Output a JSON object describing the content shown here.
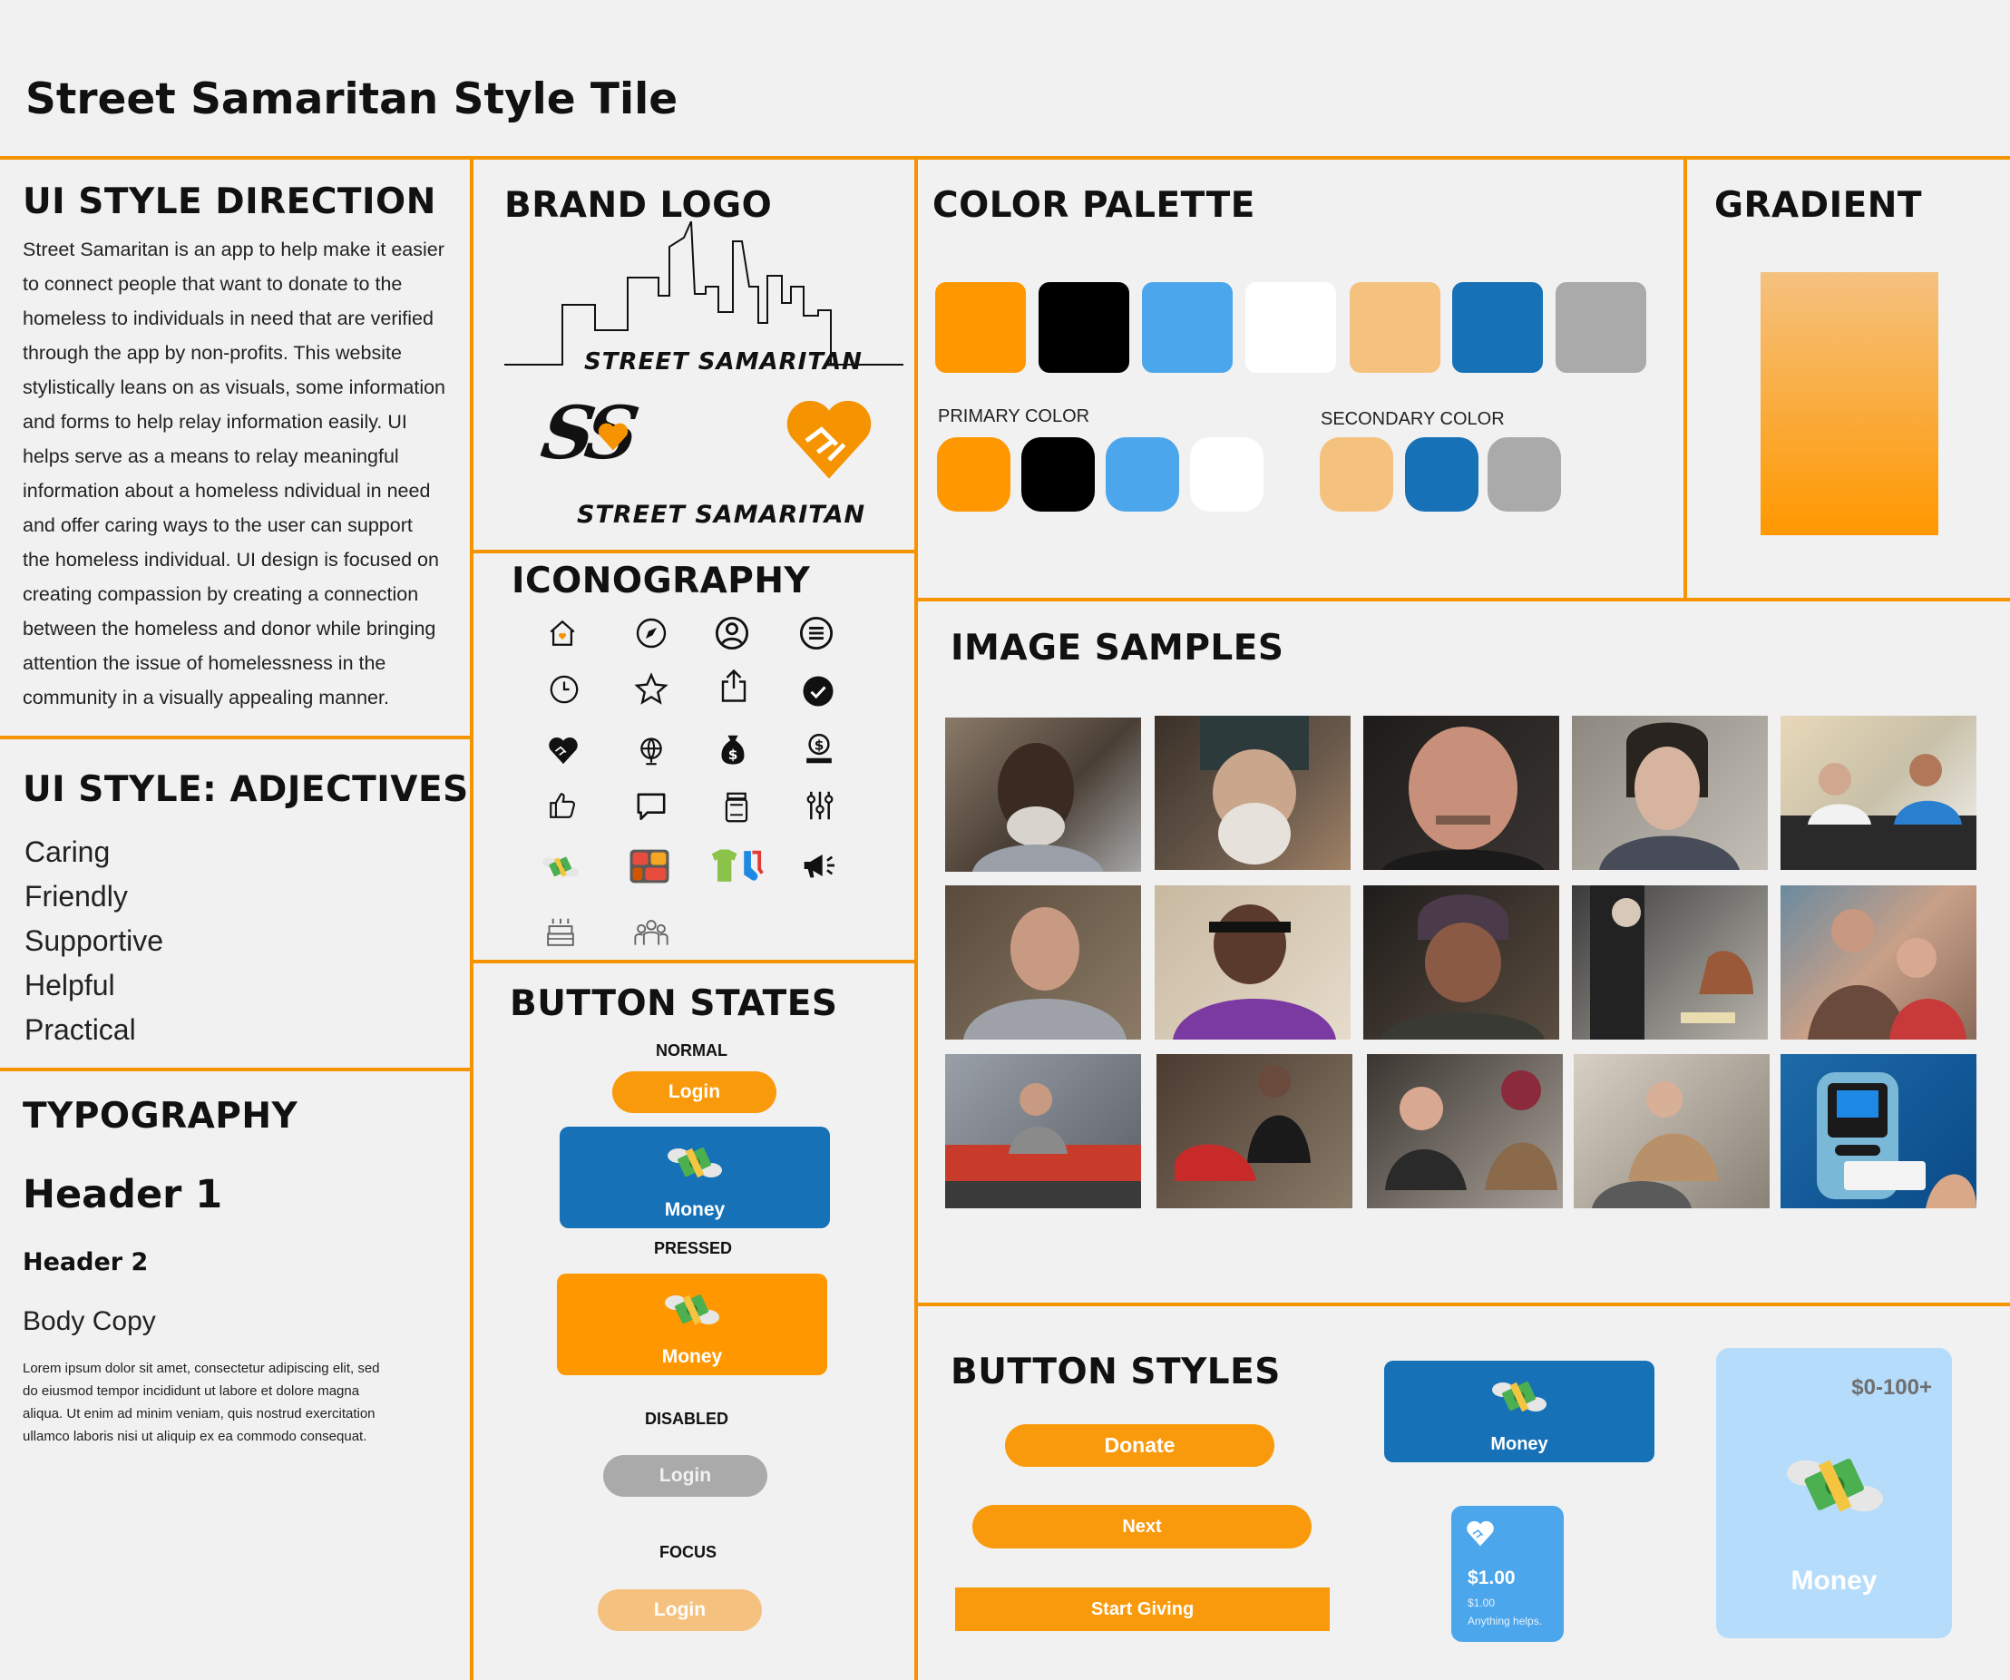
{
  "title": "Street Samaritan Style Tile",
  "sections": {
    "direction": {
      "heading": "UI STYLE DIRECTION",
      "lines": [
        "Street Samaritan is an app to help make it easier",
        "to connect people that want to donate to the",
        "homeless to individuals in need that are verified",
        "through the app by non-profits. This website",
        "stylistically leans on as visuals, some information",
        "and forms to help relay information easily. UI",
        "helps serve as a means to relay meaningful",
        "information about a homeless ndividual in need",
        "and offer caring ways to the user can support",
        "the homeless individual. UI design is focused on",
        "creating compassion by creating a connection",
        "between the homeless and donor while bringing",
        "attention the issue of homelessness in the",
        "community in a visually appealing manner."
      ]
    },
    "adjectives": {
      "heading": "UI STYLE: ADJECTIVES",
      "items": [
        "Caring",
        "Friendly",
        "Supportive",
        "Helpful",
        "Practical"
      ]
    },
    "typography": {
      "heading": "TYPOGRAPHY",
      "header1": "Header 1",
      "header2": "Header 2",
      "body_label": "Body Copy",
      "lorem": [
        "Lorem ipsum dolor sit amet, consectetur adipiscing elit, sed",
        "do eiusmod tempor incididunt ut labore et dolore magna",
        "aliqua. Ut enim ad minim veniam, quis nostrud exercitation",
        "ullamco laboris nisi ut aliquip ex ea commodo consequat."
      ]
    },
    "brand": {
      "heading": "BRAND LOGO",
      "wordmark": "STREET SAMARITAN",
      "monogram": "SS"
    },
    "iconography": {
      "heading": "ICONOGRAPHY",
      "icons": [
        "home-heart-icon",
        "navigation-icon",
        "user-circle-icon",
        "menu-circle-icon",
        "clock-icon",
        "star-icon",
        "share-icon",
        "check-circle-icon",
        "heart-hands-icon",
        "globe-icon",
        "money-bag-icon",
        "donation-icon",
        "thumbs-up-icon",
        "chat-icon",
        "jar-icon",
        "sliders-icon",
        "flying-money-icon",
        "meal-tray-icon",
        "clothes-icon",
        "megaphone-icon",
        "birthday-cake-icon",
        "community-icon"
      ]
    },
    "button_states": {
      "heading": "BUTTON STATES",
      "normal_label": "NORMAL",
      "pressed_label": "PRESSED",
      "disabled_label": "DISABLED",
      "focus_label": "FOCUS",
      "login": "Login",
      "money": "Money"
    },
    "palette": {
      "heading": "COLOR PALETTE",
      "primary_label": "PRIMARY COLOR",
      "secondary_label": "SECONDARY COLOR",
      "all_colors": [
        "#ff9800",
        "#000000",
        "#4ba6ec",
        "#ffffff",
        "#f5c17f",
        "#1671b7",
        "#aaaaaa"
      ],
      "primary_colors": [
        "#ff9800",
        "#000000",
        "#4ba6ec",
        "#ffffff"
      ],
      "secondary_colors": [
        "#f5c17f",
        "#1671b7",
        "#aaaaaa"
      ]
    },
    "gradient": {
      "heading": "GRADIENT",
      "from": "#f5c17f",
      "to": "#ff9800"
    },
    "images": {
      "heading": "IMAGE SAMPLES"
    },
    "button_styles": {
      "heading": "BUTTON STYLES",
      "donate": "Donate",
      "next": "Next",
      "start_giving": "Start Giving",
      "money": "Money",
      "card_amount": "$1.00",
      "card_sub_amount": "$1.00",
      "card_note": "Anything helps.",
      "big_range": "$0-100+",
      "big_money": "Money"
    }
  }
}
